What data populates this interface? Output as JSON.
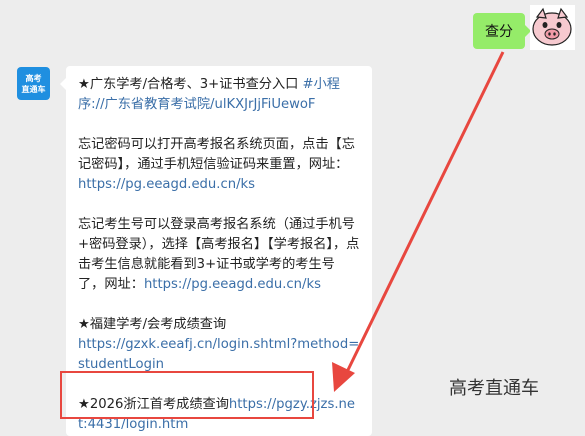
{
  "outgoing": {
    "text": "查分"
  },
  "bot": {
    "avatar_line1": "高考",
    "avatar_line2": "直通车"
  },
  "message": {
    "p1_text": "★广东学考/合格考、3+证书查分入口 ",
    "p1_link": "#小程序://广东省教育考试院/ulKXJrJjFiUewoF",
    "p2_text": "忘记密码可以打开高考报名系统页面，点击【忘记密码】，通过手机短信验证码来重置，网址：",
    "p2_link": "https://pg.eeagd.edu.cn/ks",
    "p3_text": "忘记考生号可以登录高考报名系统（通过手机号+密码登录），选择【高考报名】【学考报名】，点击考生信息就能看到3+证书或学考的考生号了，网址：",
    "p3_link": "https://pg.eeagd.edu.cn/ks",
    "p4_text": "★福建学考/会考成绩查询",
    "p4_link": "https://gzxk.eeafj.cn/login.shtml?method=studentLogin",
    "p5_text": "★2026浙江首考成绩查询",
    "p5_link": "https://pgzy.zjzs.net:4431/login.htm"
  },
  "watermark": "高考直通车",
  "colors": {
    "highlight": "#e8473f",
    "link": "#3b6fa8",
    "outgoing_bubble": "#95ec69"
  }
}
